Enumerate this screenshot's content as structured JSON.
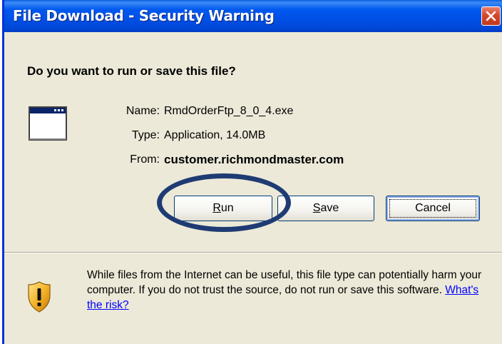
{
  "window": {
    "title": "File Download - Security Warning"
  },
  "dialog": {
    "question": "Do you want to run or save this file?",
    "name_label": "Name:",
    "name_value": "RmdOrderFtp_8_0_4.exe",
    "type_label": "Type:",
    "type_value": "Application, 14.0MB",
    "from_label": "From:",
    "from_value": "customer.richmondmaster.com"
  },
  "buttons": {
    "run_access_key": "R",
    "run_rest": "un",
    "save_access_key": "S",
    "save_rest": "ave",
    "cancel": "Cancel"
  },
  "warning": {
    "text": "While files from the Internet can be useful, this file type can potentially harm your computer. If you do not trust the source, do not run or save this software. ",
    "link": "What's the risk?"
  },
  "icons": {
    "close": "close-icon",
    "application": "application-window-icon",
    "warning": "security-shield-warning-icon"
  },
  "colors": {
    "titlebar": "#0054e3",
    "dialog_bg": "#ece9d8",
    "close_button": "#d6472a",
    "highlight_ellipse": "#1f3b73",
    "link": "#0000ff"
  }
}
